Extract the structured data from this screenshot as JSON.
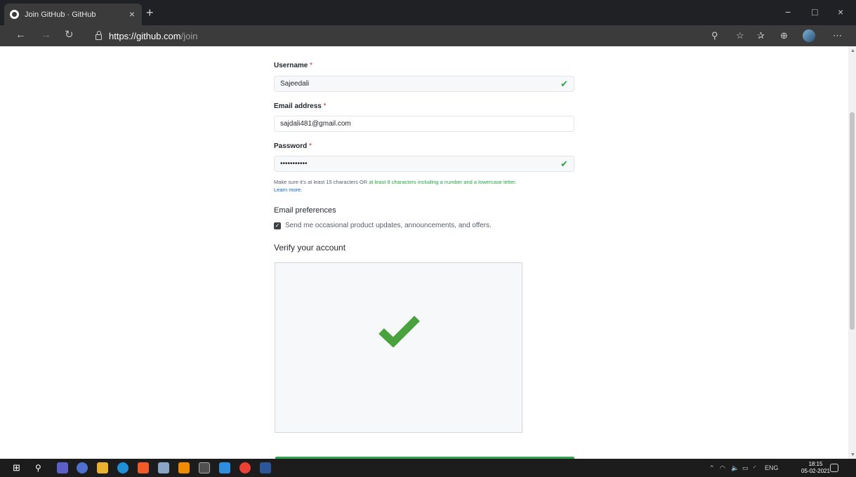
{
  "browser": {
    "tab_title": "Join GitHub · GitHub",
    "tab_close": "×",
    "new_tab": "+",
    "url_host": "https://github.com",
    "url_path": "/join",
    "window_minimize": "−",
    "window_restore": "□",
    "window_close": "×"
  },
  "form": {
    "username_label": "Username",
    "required_marker": "*",
    "username_value": "Sajeedali",
    "email_label": "Email address",
    "email_value": "sajdali481@gmail.com",
    "password_label": "Password",
    "password_value": "•••••••••••",
    "hint_prefix": "Make sure it's at least 15 characters OR ",
    "hint_green": "at least 8 characters including a number and a lowercase letter.",
    "hint_link": "Learn more.",
    "email_prefs_title": "Email preferences",
    "email_prefs_checkbox": "Send me occasional product updates, announcements, and offers.",
    "email_prefs_checked": true,
    "verify_title": "Verify your account",
    "valid_check": "✔"
  },
  "colors": {
    "success_green": "#28a745",
    "captcha_check_green": "#4aa23e",
    "link_blue": "#0366d6",
    "required_red": "#cb2431"
  },
  "taskbar": {
    "icons": [
      "windows-start-icon",
      "search-icon",
      "teams-icon",
      "app-icon",
      "file-explorer-icon",
      "edge-icon",
      "brave-icon",
      "app-icon",
      "vlc-icon",
      "terminal-icon",
      "vscode-icon",
      "chrome-icon",
      "word-icon"
    ],
    "language": "ENG",
    "time": "18:15",
    "date": "05-02-2021"
  }
}
